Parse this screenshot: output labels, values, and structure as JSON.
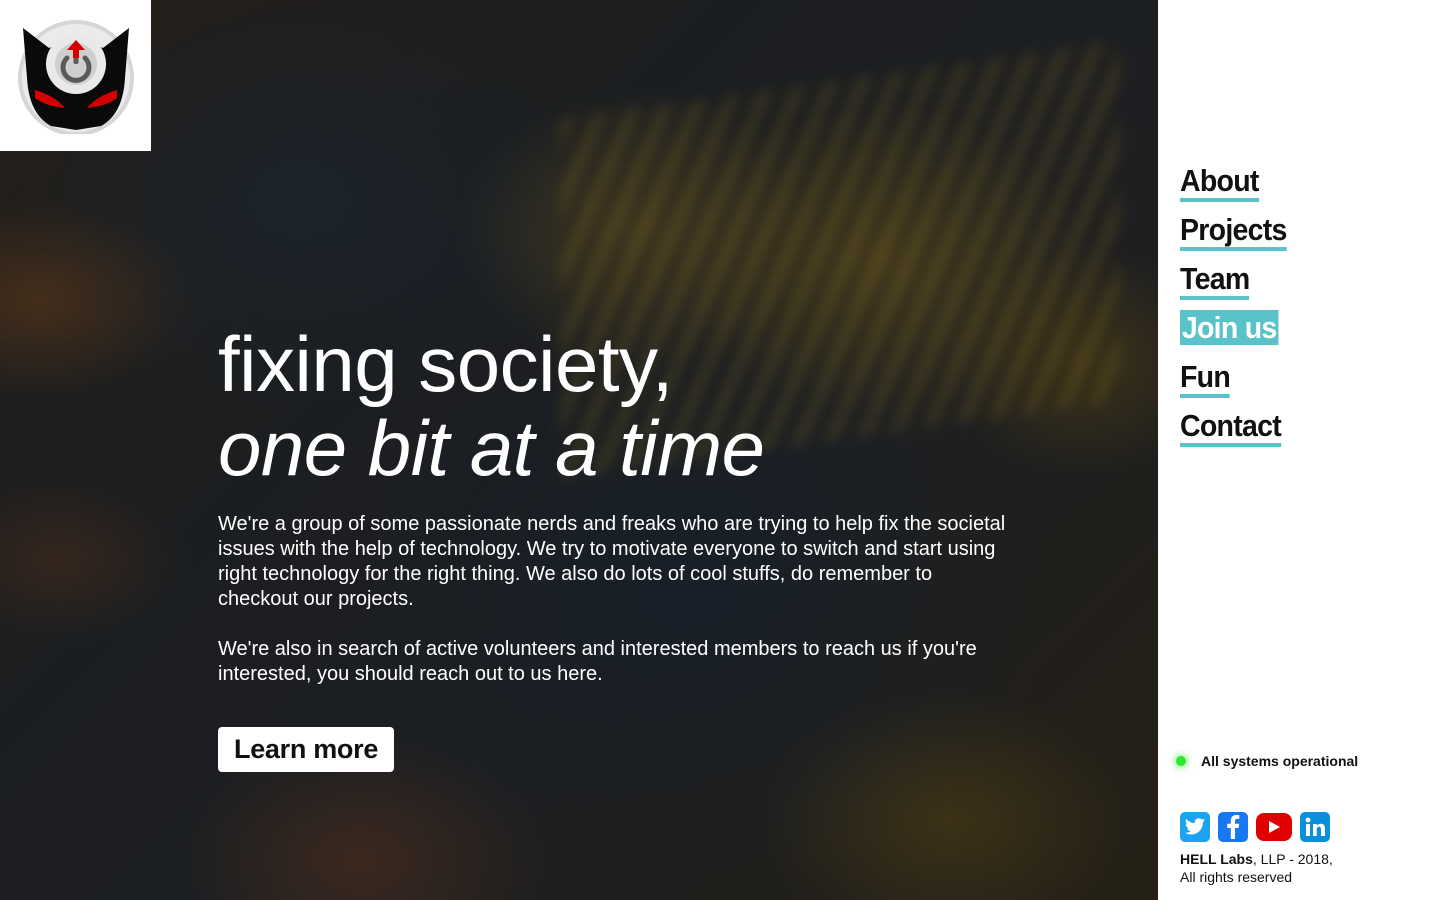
{
  "brand": {
    "logo_icon": "devil-power-logo-icon",
    "accent_color": "#5ac2c9"
  },
  "hero": {
    "headline_line1": "fixing society,",
    "headline_line2": "one bit at a time",
    "paragraph1": "We're a group of some passionate nerds and freaks who are trying to help fix the societal issues with the help of technology. We try to motivate everyone to switch and start using right technology for the right thing. We also do lots of cool stuffs, do remember to checkout our projects.",
    "paragraph2": "We're also in search of active volunteers and interested members to reach us if you're interested, you should reach out to us here.",
    "cta_label": "Learn more"
  },
  "nav": {
    "items": [
      {
        "label": "About",
        "active": false
      },
      {
        "label": "Projects",
        "active": false
      },
      {
        "label": "Team",
        "active": false
      },
      {
        "label": "Join us",
        "active": true
      },
      {
        "label": "Fun",
        "active": false
      },
      {
        "label": "Contact",
        "active": false
      }
    ]
  },
  "status": {
    "text": "All systems operational",
    "color": "#2ee82e"
  },
  "socials": [
    {
      "name": "twitter-icon",
      "color": "#1da1f2"
    },
    {
      "name": "facebook-icon",
      "color": "#1877f2"
    },
    {
      "name": "youtube-icon",
      "color": "#e00000"
    },
    {
      "name": "linkedin-icon",
      "color": "#0a8fd8"
    }
  ],
  "footer": {
    "company": "HELL Labs",
    "rest": ", LLP - 2018,",
    "rights": "All rights reserved"
  }
}
